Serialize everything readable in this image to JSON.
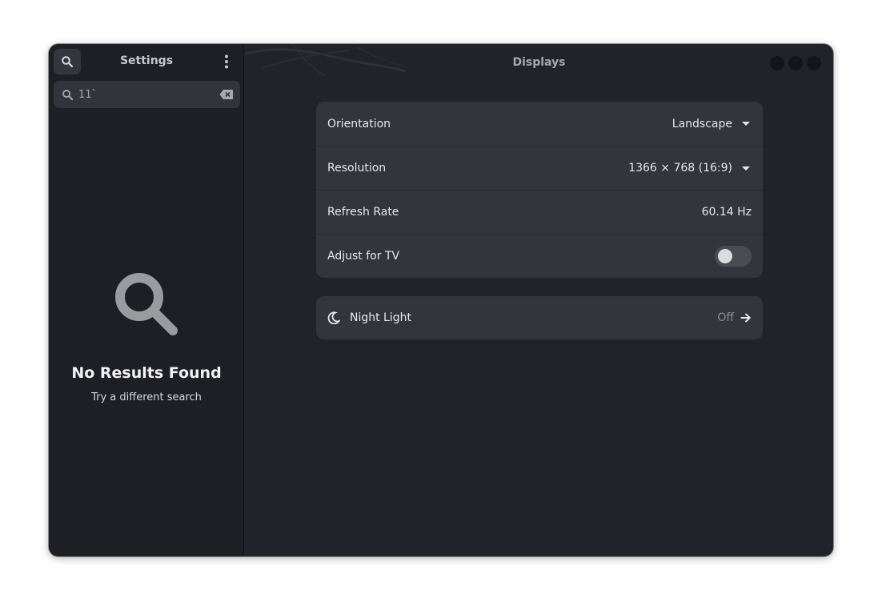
{
  "sidebar": {
    "title": "Settings",
    "search": {
      "value": "11`",
      "placeholder": ""
    },
    "empty": {
      "title": "No Results Found",
      "subtitle": "Try a different search"
    }
  },
  "main": {
    "title": "Displays",
    "display_settings": {
      "orientation": {
        "label": "Orientation",
        "value": "Landscape"
      },
      "resolution": {
        "label": "Resolution",
        "value": "1366 × 768 (16:9)"
      },
      "refresh_rate": {
        "label": "Refresh Rate",
        "value": "60.14 Hz"
      },
      "adjust_for_tv": {
        "label": "Adjust for TV",
        "enabled": false
      }
    },
    "night_light": {
      "label": "Night Light",
      "status": "Off"
    }
  },
  "icons": {
    "search": "search-icon",
    "menu": "vertical-dots-icon",
    "clear": "backspace-clear-icon",
    "moon": "moon-icon",
    "arrow": "arrow-right-icon"
  },
  "colors": {
    "window_bg": "#22232a",
    "sidebar_bg": "#1e1f25",
    "card_bg": "#33353c"
  }
}
